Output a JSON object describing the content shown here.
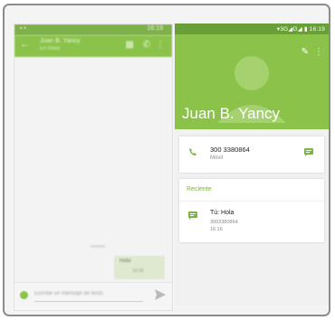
{
  "chat": {
    "title": "Juan B. Yancy",
    "subtitle": "En línea",
    "status_time": "16:19",
    "bubble_message": "Hola",
    "bubble_time": "16:16",
    "input_placeholder": "Escribe un mensaje de texto"
  },
  "contact": {
    "status_bar": "▾3G◢G◢ ▮ 16:19",
    "name": "Juan B. Yancy",
    "phone": {
      "number": "300 3380864",
      "type": "Móvil"
    },
    "recent": {
      "header": "Reciente",
      "message": "Tú: Hola",
      "number": "3003380864",
      "time": "16:16"
    }
  },
  "colors": {
    "accent": "#8bc34a",
    "status_bar": "#689f38",
    "recent_header": "#7cb342"
  },
  "icons": {
    "edit": "edit-icon",
    "more": "more-vert-icon",
    "phone": "phone-icon",
    "message": "message-icon",
    "send": "send-icon"
  }
}
